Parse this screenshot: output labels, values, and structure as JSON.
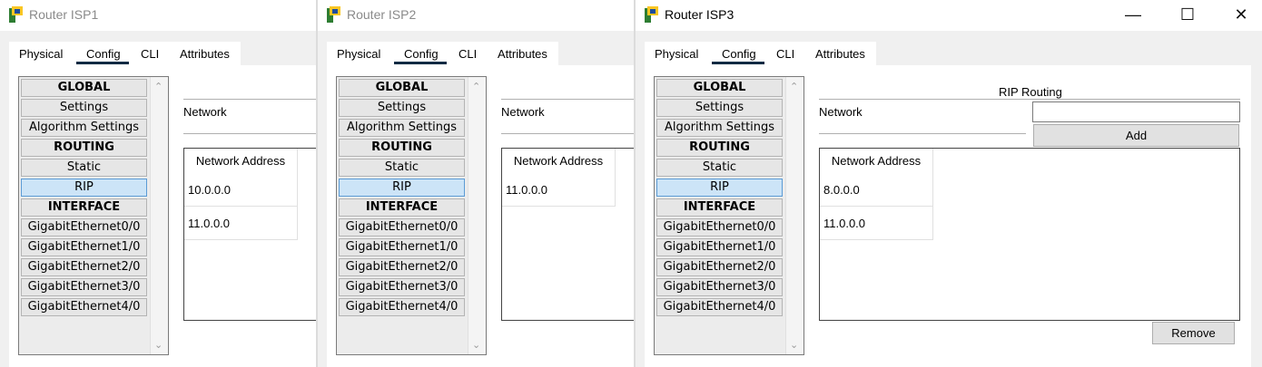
{
  "colors": {
    "tab_underline": "#102a43",
    "selected_nav": "#cce4f7",
    "window_bg": "#f0f0f0"
  },
  "tabs": [
    "Physical",
    "Config",
    "CLI",
    "Attributes"
  ],
  "nav_items": [
    "GLOBAL",
    "Settings",
    "Algorithm Settings",
    "ROUTING",
    "Static",
    "RIP",
    "INTERFACE",
    "GigabitEthernet0/0",
    "GigabitEthernet1/0",
    "GigabitEthernet2/0",
    "GigabitEthernet3/0",
    "GigabitEthernet4/0"
  ],
  "windows": [
    {
      "title": "Router ISP1",
      "network_label": "Network",
      "table_header": "Network Address",
      "networks": [
        "10.0.0.0",
        "11.0.0.0"
      ]
    },
    {
      "title": "Router ISP2",
      "network_label": "Network",
      "table_header": "Network Address",
      "networks": [
        "11.0.0.0"
      ]
    },
    {
      "title": "Router ISP3",
      "section_title": "RIP Routing",
      "network_label": "Network",
      "network_input_value": "",
      "add_label": "Add",
      "remove_label": "Remove",
      "table_header": "Network Address",
      "networks": [
        "8.0.0.0",
        "11.0.0.0"
      ],
      "window_controls": {
        "minimize": "—",
        "maximize": "☐",
        "close": "✕"
      }
    }
  ]
}
